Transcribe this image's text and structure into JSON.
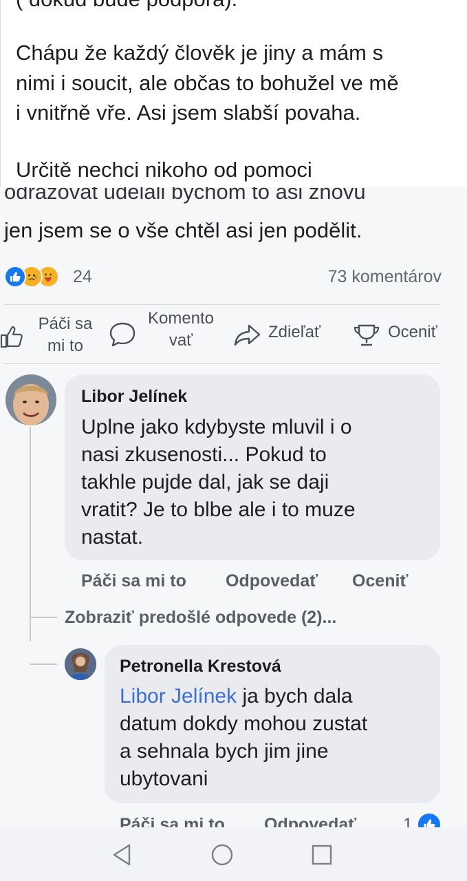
{
  "post": {
    "top_lines": [
      "( dokud bude  podpora).",
      "",
      "Chápu že každý člověk je jiny a mám  s",
      "nimi i soucit, ale občas to bohužel ve mě",
      "i vnitřně vře. Asi jsem slabší povaha.",
      "",
      "Určitě nechci nikoho od pomoci"
    ],
    "continued_lines": [
      "odrazovat udělali bychom to asi znovu",
      "jen jsem se o vše chtěl asi jen podělit."
    ]
  },
  "reactions": {
    "count": "24",
    "comments_count": "73 komentárov",
    "icons": [
      "like-icon",
      "sad-icon",
      "care-icon"
    ]
  },
  "actions": {
    "like_line1": "Páči sa",
    "like_line2": "mi to",
    "comment_line1": "Komento",
    "comment_line2": "vať",
    "share": "Zdieľať",
    "award": "Oceniť"
  },
  "comments": [
    {
      "author": "Libor Jelínek",
      "lines": [
        "Uplne jako kdybyste mluvil i o",
        "nasi zkusenosti... Pokud to",
        "takhle pujde dal, jak se daji",
        "vratit? Je to blbe ale i to muze",
        "nastat."
      ],
      "like": "Páči sa mi to",
      "reply": "Odpovedať",
      "award": "Oceniť"
    }
  ],
  "more_replies": "Zobraziť predošlé odpovede (2)...",
  "reply": {
    "author": "Petronella Krestová",
    "mention": "Libor Jelínek",
    "first_line_rest": " ja bych dala",
    "lines": [
      "datum dokdy mohou zustat",
      "a sehnala bych jim jine",
      "ubytovani"
    ],
    "like": "Páči sa mi to",
    "reply_label": "Odpovedať",
    "reaction_count": "1"
  },
  "navbar": {
    "icons": [
      "back-icon",
      "home-icon",
      "recents-icon"
    ]
  },
  "colors": {
    "accent": "#1877f2",
    "mention": "#3a6fd8",
    "bubble": "#e9ebee",
    "background": "#f6f7f9"
  }
}
